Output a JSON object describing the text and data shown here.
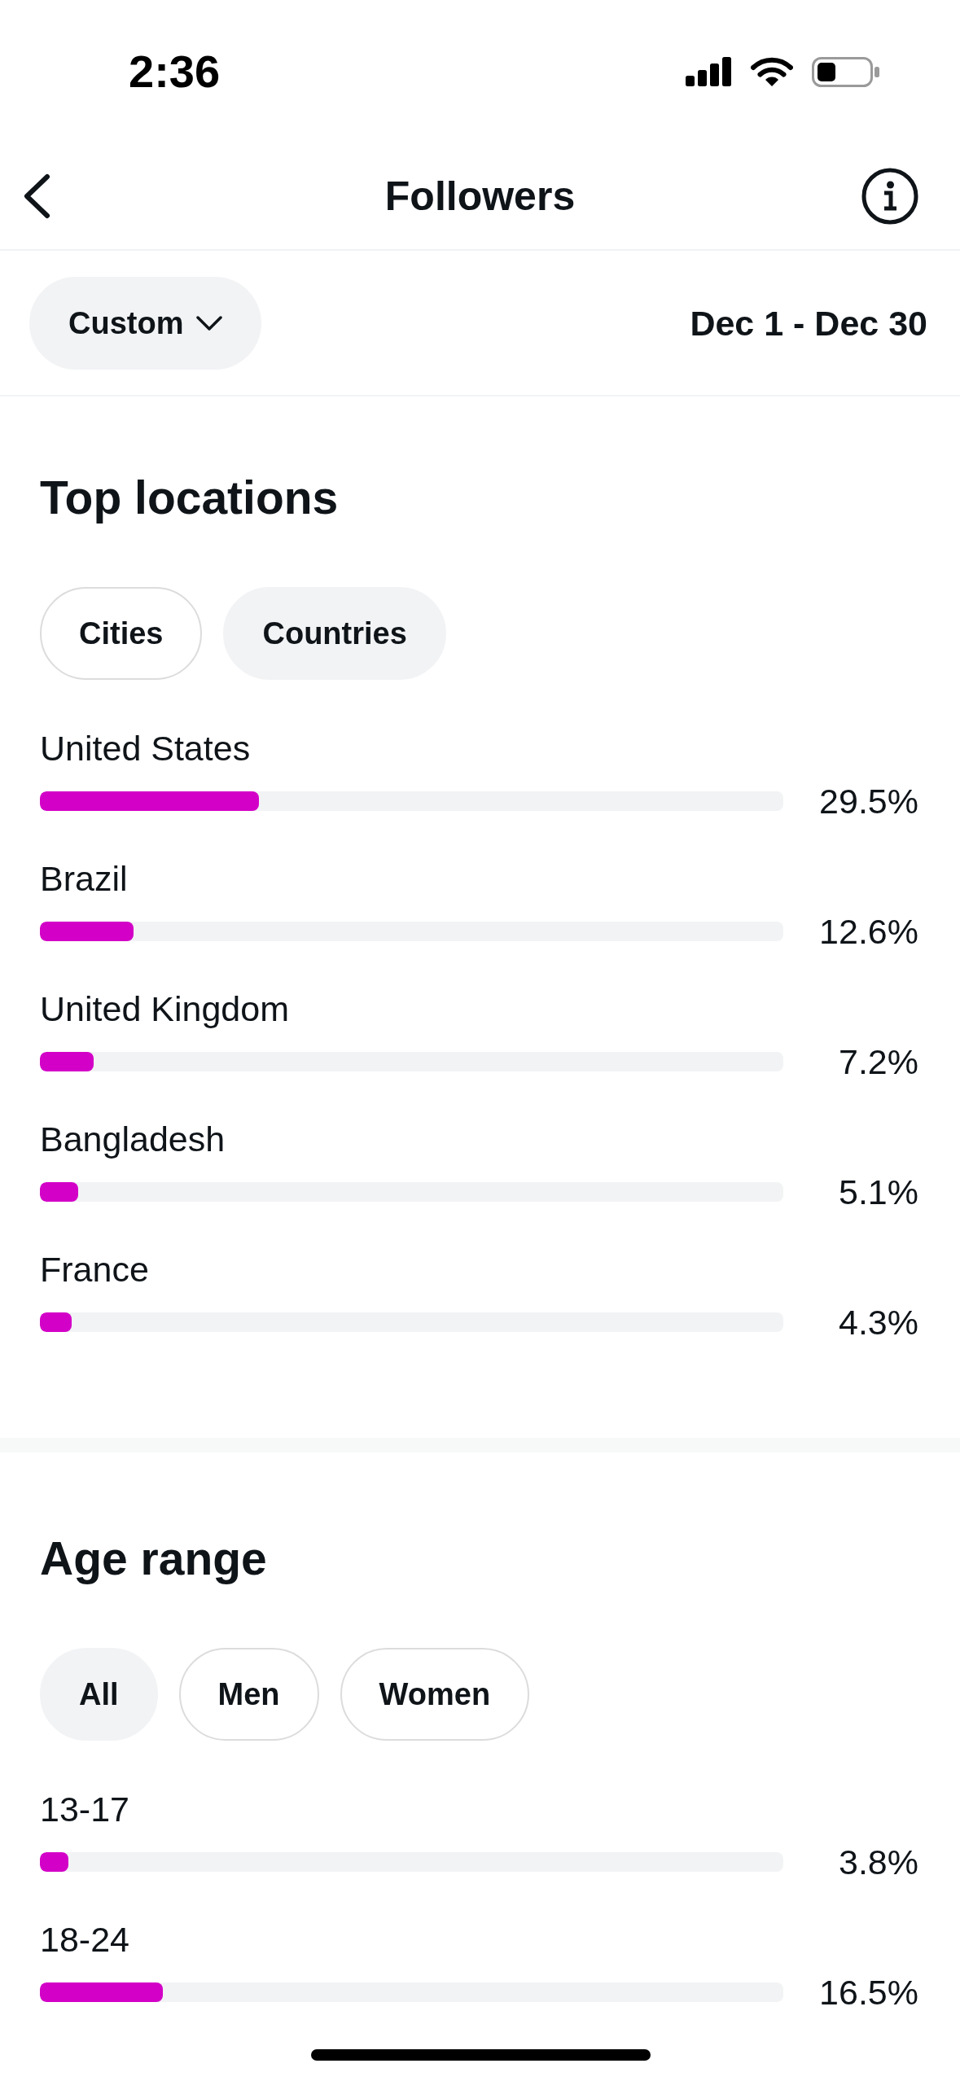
{
  "status_bar": {
    "time": "2:36"
  },
  "nav": {
    "title": "Followers"
  },
  "filter": {
    "period": "Custom",
    "date_range": "Dec 1 - Dec 30"
  },
  "sections": [
    {
      "title": "Top locations",
      "chips": [
        {
          "label": "Cities",
          "selected": false
        },
        {
          "label": "Countries",
          "selected": true
        }
      ],
      "rows": [
        {
          "label": "United States",
          "level": 0.295,
          "reading": "29.5%"
        },
        {
          "label": "Brazil",
          "level": 0.126,
          "reading": "12.6%"
        },
        {
          "label": "United Kingdom",
          "level": 0.072,
          "reading": "7.2%"
        },
        {
          "label": "Bangladesh",
          "level": 0.051,
          "reading": "5.1%"
        },
        {
          "label": "France",
          "level": 0.043,
          "reading": "4.3%"
        }
      ]
    },
    {
      "title": "Age range",
      "chips": [
        {
          "label": "All",
          "selected": true
        },
        {
          "label": "Men",
          "selected": false
        },
        {
          "label": "Women",
          "selected": false
        }
      ],
      "rows": [
        {
          "label": "13-17",
          "level": 0.038,
          "reading": "3.8%"
        },
        {
          "label": "18-24",
          "level": 0.165,
          "reading": "16.5%"
        }
      ]
    }
  ]
}
